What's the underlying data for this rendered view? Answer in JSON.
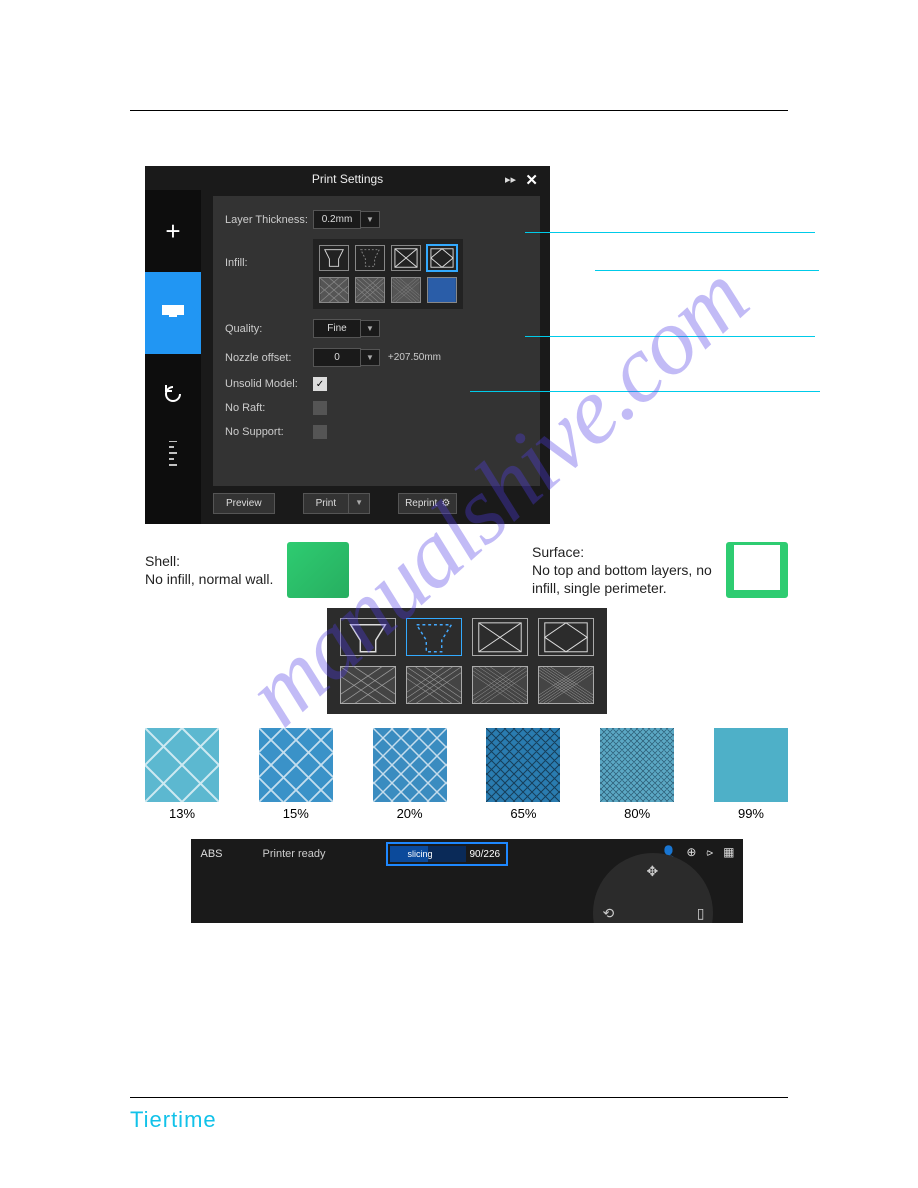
{
  "watermark": "manualshive.com",
  "brand": "Tiertime",
  "screenshot1": {
    "title": "Print Settings",
    "forward_icon": "forward-icon",
    "close_icon": "close-icon",
    "labels": {
      "layer_thickness": "Layer Thickness:",
      "infill": "Infill:",
      "quality": "Quality:",
      "nozzle_offset": "Nozzle offset:",
      "unsolid_model": "Unsolid Model:",
      "no_raft": "No Raft:",
      "no_support": "No Support:"
    },
    "values": {
      "layer_thickness": "0.2mm",
      "quality": "Fine",
      "nozzle_offset": "0",
      "nozzle_offset_text": "+207.50mm",
      "unsolid_checked": "✓"
    },
    "buttons": {
      "preview": "Preview",
      "print": "Print",
      "reprint": "Reprint"
    }
  },
  "section2": {
    "shell_title": "Shell:",
    "shell_desc": "No infill, normal wall.",
    "surface_title": "Surface:",
    "surface_desc": "No top and bottom layers, no infill, single perimeter.",
    "swatches": [
      "13%",
      "15%",
      "20%",
      "65%",
      "80%",
      "99%"
    ]
  },
  "section3": {
    "material": "ABS",
    "status": "Printer ready",
    "progress_label": "slicing",
    "progress_value": "90/226"
  }
}
